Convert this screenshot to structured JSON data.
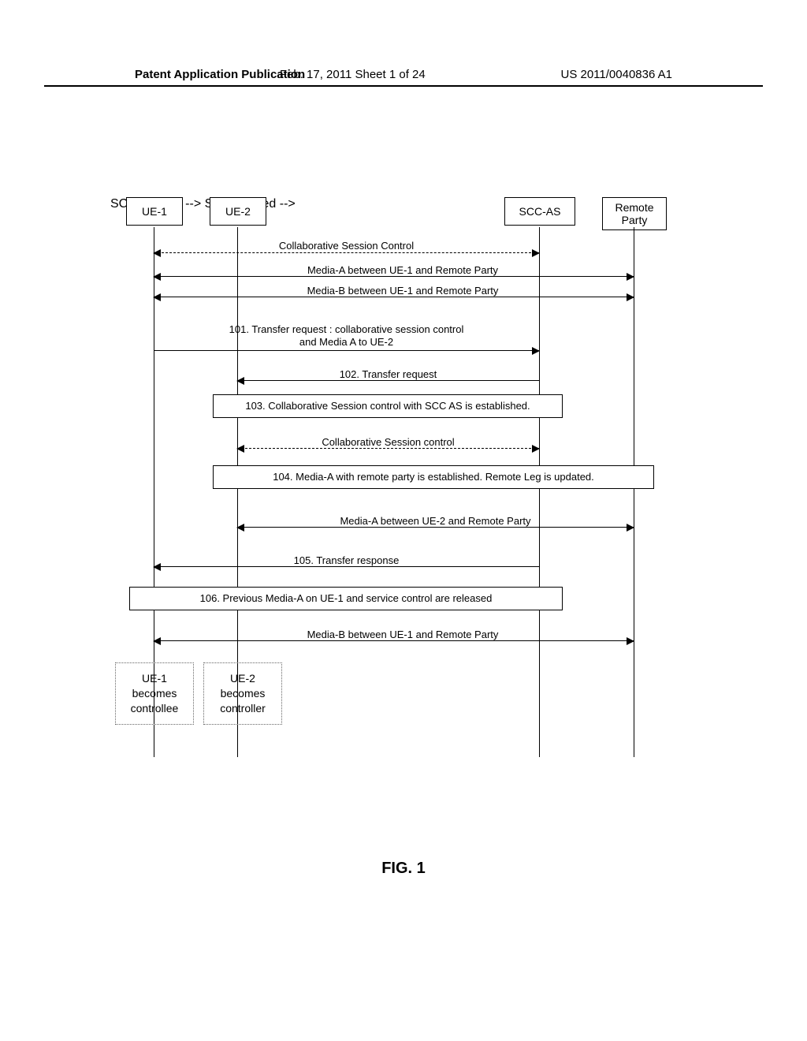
{
  "header": {
    "left": "Patent Application Publication",
    "center": "Feb. 17, 2011  Sheet 1 of 24",
    "right": "US 2011/0040836 A1"
  },
  "participants": {
    "ue1": "UE-1",
    "ue2": "UE-2",
    "scc": "SCC-AS",
    "rp": "Remote Party"
  },
  "messages": {
    "m0": "Collaborative Session Control",
    "m1": "Media-A between UE-1 and Remote Party",
    "m2": "Media-B between UE-1 and Remote Party",
    "m3_l1": "101. Transfer request : collaborative session control",
    "m3_l2": "and Media A to UE-2",
    "m4": "102.  Transfer request",
    "m5": "103.  Collaborative Session control with SCC AS is established.",
    "m6": "Collaborative Session control",
    "m7": "104.  Media-A with remote party is established. Remote Leg is updated.",
    "m8": "Media-A between UE-2 and Remote Party",
    "m9": "105.  Transfer response",
    "m10": "106.  Previous Media-A on UE-1 and service control are released",
    "m11": "Media-B between UE-1 and Remote Party"
  },
  "endnotes": {
    "ue1": "UE-1 becomes controllee",
    "ue2": "UE-2 becomes controller"
  },
  "figure_label": "FIG. 1"
}
